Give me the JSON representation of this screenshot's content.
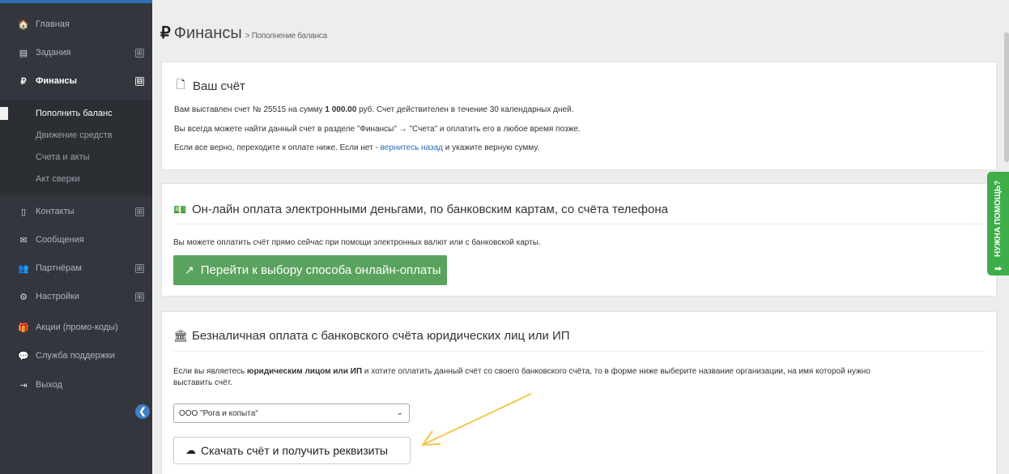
{
  "sidebar": {
    "items": [
      {
        "label": "Главная",
        "icon": "home-icon",
        "glyph": "🏠"
      },
      {
        "label": "Задания",
        "icon": "tasks-icon",
        "glyph": "▤",
        "toggle": "⊞"
      },
      {
        "label": "Финансы",
        "icon": "ruble-icon",
        "glyph": "₽",
        "toggle": "⊟"
      },
      {
        "label": "Контакты",
        "icon": "contacts-icon",
        "glyph": "▯",
        "toggle": "⊞"
      },
      {
        "label": "Сообщения",
        "icon": "envelope-icon",
        "glyph": "✉"
      },
      {
        "label": "Партнёрам",
        "icon": "users-icon",
        "glyph": "👥",
        "toggle": "⊞"
      },
      {
        "label": "Настройки",
        "icon": "gear-icon",
        "glyph": "⚙",
        "toggle": "⊞"
      },
      {
        "label": "Акции (промо-коды)",
        "icon": "gift-icon",
        "glyph": "🎁"
      },
      {
        "label": "Служба поддержки",
        "icon": "chat-icon",
        "glyph": "💬"
      },
      {
        "label": "Выход",
        "icon": "logout-icon",
        "glyph": "⇥"
      }
    ],
    "finance_submenu": [
      {
        "label": "Пополнить баланс"
      },
      {
        "label": "Движение средств"
      },
      {
        "label": "Счета и акты"
      },
      {
        "label": "Акт сверки"
      }
    ],
    "collapse_glyph": "❮"
  },
  "header": {
    "currency_glyph": "₽",
    "title": "Финансы",
    "breadcrumb": "> Пополнение баланса"
  },
  "invoice_panel": {
    "title": "Ваш счёт",
    "line1_prefix": "Вам выставлен счет № 25515 на сумму ",
    "line1_amount": "1 000.00",
    "line1_suffix": " руб. Счет действителен в течение 30 календарных дней.",
    "line2": "Вы всегда можете найти данный счет в разделе \"Финансы\" → \"Счета\" и оплатить его в любое время позже.",
    "line3_prefix": "Если все верно, переходите к оплате ниже. Если нет - ",
    "line3_link": "вернитесь назад",
    "line3_suffix": " и укажите верную сумму."
  },
  "online_panel": {
    "title": "Он-лайн оплата электронными деньгами, по банковским картам, со счёта телефона",
    "text": "Вы можете оплатить счёт прямо сейчас при помощи электронных валют или с банковской карты.",
    "button_label": "Перейти к выбору способа онлайн-оплаты"
  },
  "bank_panel": {
    "title": "Безналичная оплата с банковского счёта юридических лиц или ИП",
    "text_prefix": "Если вы являетесь ",
    "text_bold": "юридическим лицом или ИП",
    "text_suffix": " и хотите оплатить данный счёт со своего банковского счёта, то в форме ниже выберите название организации, на имя которой нужно",
    "text_line2": "выставить счёт.",
    "select_value": "ООО \"Рога и копыта\"",
    "button_label": "Скачать счёт и получить реквизиты"
  },
  "help_tab": {
    "label": "НУЖНА ПОМОЩЬ?"
  },
  "colors": {
    "sidebar_bg": "#33373d",
    "accent_blue": "#3f7fc3",
    "green_button": "#5aa35e",
    "help_green": "#3fae49",
    "annotation_arrow": "#f2c84b"
  }
}
